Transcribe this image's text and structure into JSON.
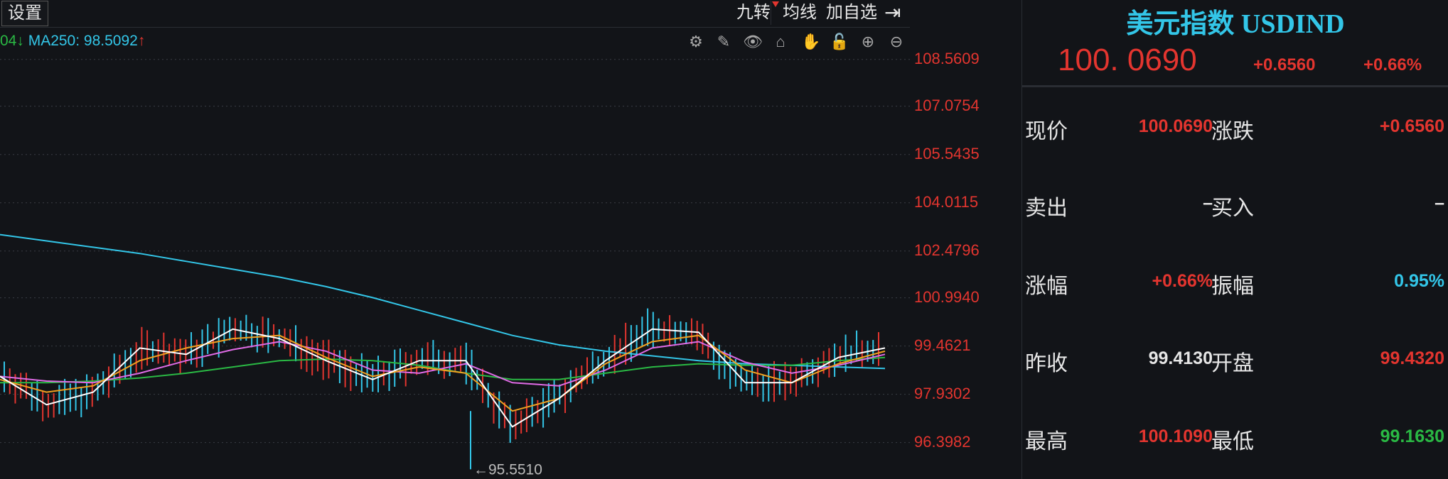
{
  "toolbar": {
    "settings_label": "设置",
    "nine_turn_label": "九转",
    "ma_label": "均线",
    "add_watch_label": "加自选",
    "collapse_icon": "collapse-right-icon"
  },
  "ma_legend": {
    "prefix": "04",
    "prefix_arrow": "↓",
    "ma250_text": "MA250: 98.5092",
    "ma250_arrow": "↑"
  },
  "chart_tools": [
    "settings-icon",
    "pen-icon",
    "eye-icon",
    "lock-box-icon",
    "hand-icon",
    "padlock-icon",
    "zoom-in-icon",
    "zoom-out-icon"
  ],
  "chart_data": {
    "type": "line",
    "title": "",
    "y_ticks": [
      "108.5609",
      "107.0754",
      "105.5435",
      "104.0115",
      "102.4796",
      "100.9940",
      "99.4621",
      "97.9302",
      "96.3982"
    ],
    "ylim": [
      95.4,
      108.6
    ],
    "min_marker": {
      "label": "95.5510",
      "value": 95.551
    },
    "series": [
      {
        "name": "MA250",
        "color": "#33c6e8",
        "values": [
          103.0,
          102.8,
          102.6,
          102.4,
          102.15,
          101.9,
          101.65,
          101.35,
          101.0,
          100.6,
          100.2,
          99.8,
          99.5,
          99.3,
          99.15,
          99.0,
          98.9,
          98.85,
          98.8,
          98.75
        ]
      },
      {
        "color": "#2ab944",
        "values": [
          98.3,
          98.3,
          98.35,
          98.45,
          98.6,
          98.8,
          99.0,
          99.05,
          99.0,
          98.85,
          98.6,
          98.4,
          98.4,
          98.6,
          98.8,
          98.9,
          98.85,
          98.85,
          99.0,
          99.1
        ]
      },
      {
        "color": "#e06be6",
        "values": [
          98.5,
          98.35,
          98.3,
          98.6,
          99.0,
          99.35,
          99.6,
          99.3,
          98.7,
          98.6,
          98.9,
          98.3,
          98.2,
          98.7,
          99.4,
          99.6,
          98.95,
          98.6,
          98.85,
          99.2
        ]
      },
      {
        "color": "#f0a020",
        "values": [
          98.4,
          98.0,
          98.2,
          99.0,
          99.4,
          99.7,
          99.8,
          99.1,
          98.5,
          98.8,
          98.6,
          97.4,
          97.8,
          98.9,
          99.6,
          99.8,
          98.7,
          98.3,
          98.9,
          99.3
        ]
      },
      {
        "color": "#ffffff",
        "values": [
          98.5,
          97.6,
          98.0,
          99.4,
          99.2,
          100.0,
          99.7,
          99.0,
          98.4,
          99.0,
          99.0,
          96.9,
          97.8,
          99.0,
          100.0,
          99.9,
          98.3,
          98.3,
          99.1,
          99.4
        ]
      }
    ]
  },
  "quote": {
    "title": "美元指数 USDIND",
    "price": "100. 0690",
    "change": "+0.6560",
    "change_pct": "+0.66%",
    "rows": [
      {
        "l1": "现价",
        "v1": "100.0690",
        "c1": "red",
        "l2": "涨跌",
        "v2": "+0.6560",
        "c2": "red"
      },
      {
        "l1": "卖出",
        "v1": "–",
        "c1": "white",
        "l2": "买入",
        "v2": "–",
        "c2": "white"
      },
      {
        "l1": "涨幅",
        "v1": "+0.66%",
        "c1": "red",
        "l2": "振幅",
        "v2": "0.95%",
        "c2": "cyan"
      },
      {
        "l1": "昨收",
        "v1": "99.4130",
        "c1": "white",
        "l2": "开盘",
        "v2": "99.4320",
        "c2": "red"
      },
      {
        "l1": "最高",
        "v1": "100.1090",
        "c1": "red",
        "l2": "最低",
        "v2": "99.1630",
        "c2": "green"
      }
    ]
  },
  "colors": {
    "up": "#e3352f",
    "down": "#2ab944",
    "cyan": "#33c6e8",
    "bg": "#121418"
  }
}
